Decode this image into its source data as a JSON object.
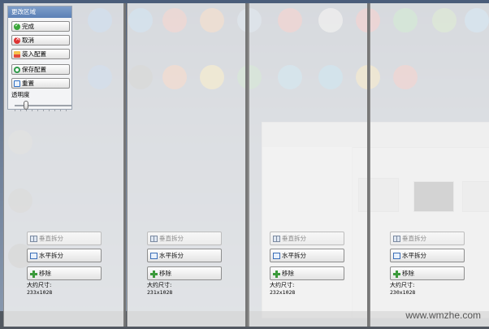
{
  "panel": {
    "title": "更改区域",
    "buttons": {
      "done": "完成",
      "cancel": "取消",
      "load_config": "装入配置",
      "save_config": "保存配置",
      "reset": "重置"
    },
    "opacity_label": "透明度",
    "opacity_value": 0.2
  },
  "columns": [
    {
      "vsplit": "垂直拆分",
      "hsplit": "水平拆分",
      "remove": "移除",
      "size_label": "大约尺寸:",
      "size_value": "233x1028"
    },
    {
      "vsplit": "垂直拆分",
      "hsplit": "水平拆分",
      "remove": "移除",
      "size_label": "大约尺寸:",
      "size_value": "231x1028"
    },
    {
      "vsplit": "垂直拆分",
      "hsplit": "水平拆分",
      "remove": "移除",
      "size_label": "大约尺寸:",
      "size_value": "232x1028"
    },
    {
      "vsplit": "垂直拆分",
      "hsplit": "水平拆分",
      "remove": "移除",
      "size_label": "大约尺寸:",
      "size_value": "230x1028"
    }
  ],
  "watermark": "www.wmzhe.com"
}
